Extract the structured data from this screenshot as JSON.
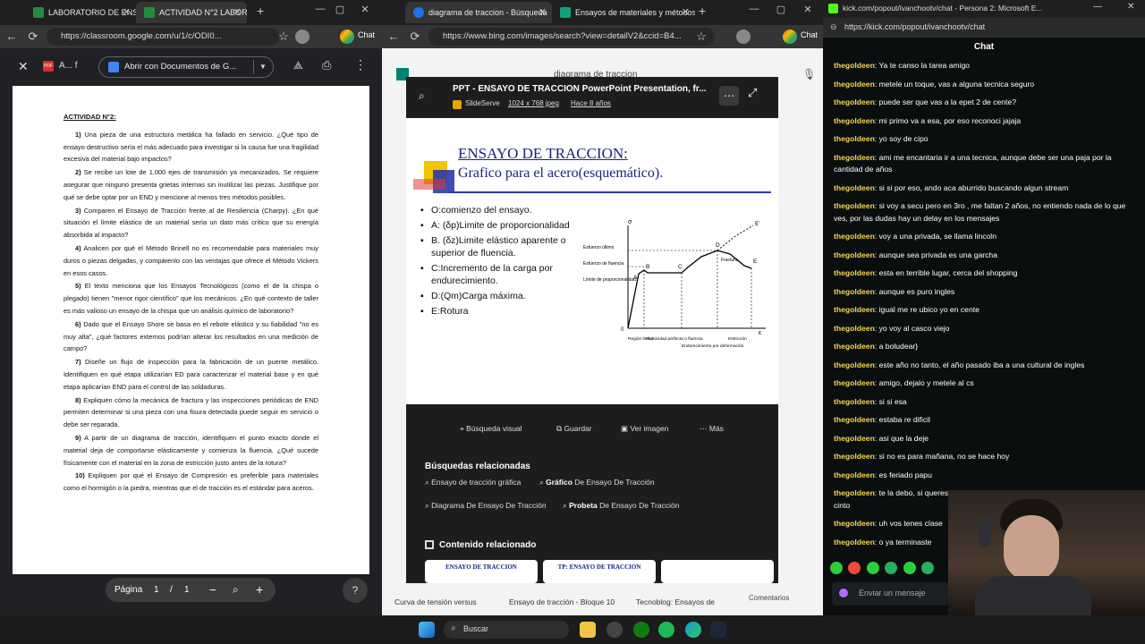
{
  "left_window": {
    "tabs": [
      {
        "label": "LABORATORIO DE ENSAY"
      },
      {
        "label": "ACTIVIDAD N°2 LABORA"
      }
    ],
    "url": "https://classroom.google.com/u/1/c/ODI0...",
    "profile_label": "Chat",
    "file_label": "A... f",
    "open_with_label": "Abrir con Documentos de G...",
    "document": {
      "heading": "ACTIVIDAD N°2:",
      "items": [
        {
          "num": "1)",
          "text": "Una pieza de una estructura metálica ha fallado en servicio. ¿Qué tipo de ensayo destructivo sería el más adecuado para investigar si la causa fue una fragilidad excesiva del material bajo impactos?"
        },
        {
          "num": "2)",
          "text": "Se recibe un lote de 1.000 ejes de transmisión ya mecanizados. Se requiere asegurar que ninguno presenta grietas internas sin inutilizar las piezas. Justifique por qué se debe optar por un END y mencione al menos tres métodos posibles."
        },
        {
          "num": "3)",
          "text": "Comparen el Ensayo de Tracción frente al de Resiliencia (Charpy). ¿En qué situación el límite elástico de un material sería un dato más crítico que su energía absorbida al impacto?"
        },
        {
          "num": "4)",
          "text": "Analicen por qué el Método Brinell no es recomendable para materiales muy duros o piezas delgadas, y compárenlo con las ventajas que ofrece el Método Vickers en esos casos."
        },
        {
          "num": "5)",
          "text": "El texto menciona que los Ensayos Tecnológicos (como el de la chispa o plegado) tienen \"menor rigor científico\" que los mecánicos. ¿En qué contexto de taller es más valioso un ensayo de la chispa que un análisis químico de laboratorio?"
        },
        {
          "num": "6)",
          "text": "Dado que el Ensayo Shore se basa en el rebote elástico y su fiabilidad \"no es muy alta\", ¿qué factores externos podrían alterar los resultados en una medición de campo?"
        },
        {
          "num": "7)",
          "text": "Diseñe un flujo de inspección para la fabricación de un puente metálico. Identifiquen en qué etapa utilizarían ED para caracterizar el material base y en qué etapa aplicarían END para el control de las soldaduras."
        },
        {
          "num": "8)",
          "text": "Expliquen cómo la mecánica de fractura y las inspecciones periódicas de END permiten determinar si una pieza con una fisura detectada puede seguir en servicio o debe ser reparada."
        },
        {
          "num": "9)",
          "text": "A partir de un diagrama de tracción, identifiquen el punto exacto donde el material deja de comportarse elásticamente y comienza la fluencia. ¿Qué sucede físicamente con el material en la zona de estricción justo antes de la rotura?"
        },
        {
          "num": "10)",
          "text": "Expliquen por qué el Ensayo de Compresión es preferible para materiales como el hormigón o la piedra, mientras que el de tracción es el estándar para aceros."
        }
      ]
    },
    "pager": {
      "label": "Página",
      "current": "1",
      "sep": "/",
      "total": "1"
    }
  },
  "middle_window": {
    "tabs": [
      {
        "label": "diagrama de traccion - Búsqueda"
      },
      {
        "label": "Ensayos de materiales y métodos"
      }
    ],
    "url": "https://www.bing.com/images/search?view=detailV2&ccid=B4...",
    "profile_label": "Chat",
    "search_query": "diagrama de traccion",
    "overlay": {
      "title": "PPT - ENSAYO DE TRACCION PowerPoint Presentation, fr...",
      "source": "SlideServe",
      "size": "1024 x 768 jpeg",
      "age": "Hace 8 años",
      "slide": {
        "title_line1": "ENSAYO DE TRACCION:",
        "title_line2": "Grafico para el acero(esquemático).",
        "bullets": [
          "O:comienzo del ensayo.",
          "A: (δp)Limite de proporcionalidad",
          "B. (δz)Limite elástico aparente o superior de fluencia.",
          "C:Incremento de la carga por endurecimiento.",
          "D:(Qm)Carga máxima.",
          "E:Rotura"
        ],
        "diagram_labels": {
          "sigma": "σ",
          "epsilon": "ε",
          "origin": "0",
          "A": "A",
          "B": "B",
          "C": "C",
          "D": "D",
          "E": "E",
          "Eprime": "E'",
          "esf_ultimo": "Esfuerzo último",
          "esf_fluencia": "Esfuerzo de fluencia",
          "limite_prop": "Límite de proporcionalidad",
          "fractura": "Fractura",
          "region_lineal": "Región lineal",
          "plasticidad": "Plasticidad perfecta o fluencia",
          "endurecimiento": "Endurecimiento por deformación",
          "estriccion": "Estricción"
        }
      },
      "actions": [
        "Búsqueda visual",
        "Guardar",
        "Ver imagen",
        "Más"
      ],
      "related_title": "Búsquedas relacionadas",
      "related": [
        {
          "pre": "Ensayo de tracción gráfica",
          "bold": ""
        },
        {
          "pre": "",
          "bold": "Gráfico",
          "post": " De Ensayo De Tracción"
        },
        {
          "pre": "Diagrama De Ensayo De Tracción",
          "bold": ""
        },
        {
          "pre": "",
          "bold": "Probeta",
          "post": " De Ensayo De Tracción"
        }
      ],
      "content_title": "Contenido relacionado",
      "thumbs": [
        "ENSAYO DE TRACCION",
        "TP: ENSAYO DE TRACCION",
        ""
      ]
    },
    "bottom_captions": [
      "Curva de tensión versus",
      "Ensayo de tracción - Bloque 10",
      "Tecnoblog: Ensayos de",
      "Comentarios"
    ]
  },
  "chat_window": {
    "title": "kick.com/popout/ivanchootv/chat - Persona 2: Microsoft E...",
    "url": "https://kick.com/popout/ivanchootv/chat",
    "header": "Chat",
    "messages": [
      {
        "user": "thegoldeen",
        "text": "Ya te canso la tarea amigo"
      },
      {
        "user": "thegoldeen",
        "text": "metele un toque, vas a alguna tecnica seguro"
      },
      {
        "user": "thegoldeen",
        "text": "puede ser que vas a la epet 2 de cente?"
      },
      {
        "user": "thegoldeen",
        "text": "mi primo va a esa, por eso reconoci jajaja"
      },
      {
        "user": "thegoldeen",
        "text": "yo soy de cipo"
      },
      {
        "user": "thegoldeen",
        "text": "ami me encantaria ir a una tecnica, aunque debe ser una paja por la cantidad de años"
      },
      {
        "user": "thegoldeen",
        "text": "si si por eso, ando aca aburrido buscando algun stream"
      },
      {
        "user": "thegoldeen",
        "text": "si voy a secu pero en 3ro , me faltan 2 años, no entiendo nada de lo que ves, por las dudas hay un delay en los mensajes"
      },
      {
        "user": "thegoldeen",
        "text": "voy a una privada, se llama lincoln"
      },
      {
        "user": "thegoldeen",
        "text": "aunque sea privada es una garcha"
      },
      {
        "user": "thegoldeen",
        "text": "esta en terrible lugar, cerca del shopping"
      },
      {
        "user": "thegoldeen",
        "text": "aunque es puro ingles"
      },
      {
        "user": "thegoldeen",
        "text": "igual me re ubico yo en cente"
      },
      {
        "user": "thegoldeen",
        "text": "yo voy al casco viejo"
      },
      {
        "user": "thegoldeen",
        "text": "a boludear}"
      },
      {
        "user": "thegoldeen",
        "text": "este año no tanto, el año pasado iba a una cultural de ingles"
      },
      {
        "user": "thegoldeen",
        "text": "amigo, dejalo y metele al cs"
      },
      {
        "user": "thegoldeen",
        "text": "si si esa"
      },
      {
        "user": "thegoldeen",
        "text": "estaba re dificil"
      },
      {
        "user": "thegoldeen",
        "text": "asi que la deje"
      },
      {
        "user": "thegoldeen",
        "text": "si no es para mañana, no se hace hoy"
      },
      {
        "user": "thegoldeen",
        "text": "es feriado papu"
      },
      {
        "user": "thegoldeen",
        "text": "te la debo, si queres alguno de estos dias, a esta hora yo me don con el cinto"
      },
      {
        "user": "thegoldeen",
        "text": "uh vos tenes clase"
      },
      {
        "user": "thegoldeen",
        "text": "o ya terminaste"
      }
    ],
    "input_placeholder": "Enviar un mensaje"
  },
  "taskbar": {
    "search_label": "Buscar"
  }
}
